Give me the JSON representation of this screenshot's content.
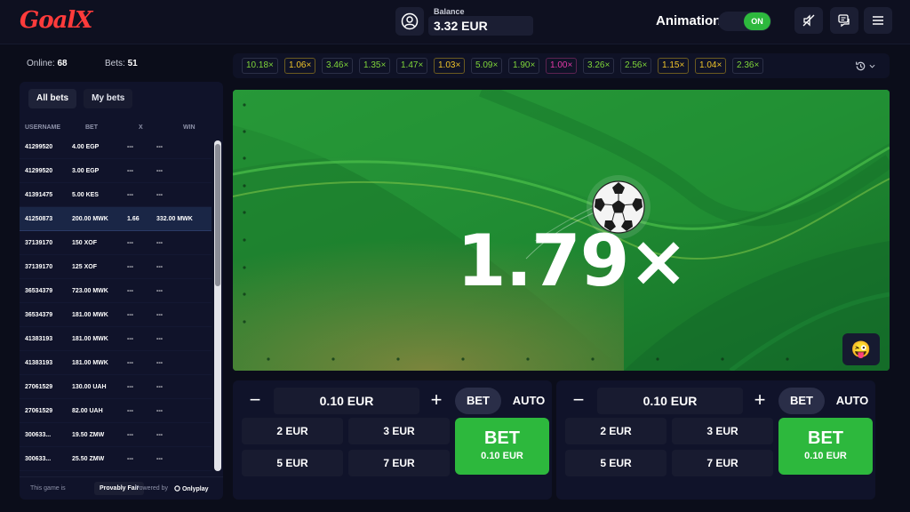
{
  "header": {
    "logo": "GoalX",
    "balance_label": "Balance",
    "balance_value": "3.32 EUR",
    "animation_label": "Animation",
    "animation_state": "ON"
  },
  "stats": {
    "online_label": "Online:",
    "online_value": "68",
    "bets_label": "Bets:",
    "bets_value": "51"
  },
  "bets_panel": {
    "tabs": [
      "All bets",
      "My bets"
    ],
    "columns": [
      "USERNAME",
      "BET",
      "X",
      "WIN"
    ],
    "rows": [
      {
        "user": "41299520",
        "bet": "4.00 EGP",
        "x": "---",
        "win": "---"
      },
      {
        "user": "41299520",
        "bet": "3.00 EGP",
        "x": "---",
        "win": "---"
      },
      {
        "user": "41391475",
        "bet": "5.00 KES",
        "x": "---",
        "win": "---"
      },
      {
        "user": "41250873",
        "bet": "200.00 MWK",
        "x": "1.66",
        "win": "332.00 MWK"
      },
      {
        "user": "37139170",
        "bet": "150 XOF",
        "x": "---",
        "win": "---"
      },
      {
        "user": "37139170",
        "bet": "125 XOF",
        "x": "---",
        "win": "---"
      },
      {
        "user": "36534379",
        "bet": "723.00 MWK",
        "x": "---",
        "win": "---"
      },
      {
        "user": "36534379",
        "bet": "181.00 MWK",
        "x": "---",
        "win": "---"
      },
      {
        "user": "41383193",
        "bet": "181.00 MWK",
        "x": "---",
        "win": "---"
      },
      {
        "user": "41383193",
        "bet": "181.00 MWK",
        "x": "---",
        "win": "---"
      },
      {
        "user": "27061529",
        "bet": "130.00 UAH",
        "x": "---",
        "win": "---"
      },
      {
        "user": "27061529",
        "bet": "82.00 UAH",
        "x": "---",
        "win": "---"
      },
      {
        "user": "300633...",
        "bet": "19.50 ZMW",
        "x": "---",
        "win": "---"
      },
      {
        "user": "300633...",
        "bet": "25.50 ZMW",
        "x": "---",
        "win": "---"
      }
    ],
    "footer_text": "This game is",
    "provably_fair": "Provably Fair",
    "powered_by": "Powered by",
    "provider": "Onlyplay"
  },
  "history": [
    {
      "value": "10.18×",
      "color": "#7fd63a"
    },
    {
      "value": "1.06×",
      "color": "#f0c42a"
    },
    {
      "value": "3.46×",
      "color": "#7fd63a"
    },
    {
      "value": "1.35×",
      "color": "#7fd63a"
    },
    {
      "value": "1.47×",
      "color": "#7fd63a"
    },
    {
      "value": "1.03×",
      "color": "#f0c42a"
    },
    {
      "value": "5.09×",
      "color": "#7fd63a"
    },
    {
      "value": "1.90×",
      "color": "#7fd63a"
    },
    {
      "value": "1.00×",
      "color": "#e33aa8"
    },
    {
      "value": "3.26×",
      "color": "#7fd63a"
    },
    {
      "value": "2.56×",
      "color": "#7fd63a"
    },
    {
      "value": "1.15×",
      "color": "#f0c42a"
    },
    {
      "value": "1.04×",
      "color": "#f0c42a"
    },
    {
      "value": "2.36×",
      "color": "#7fd63a"
    }
  ],
  "game": {
    "multiplier": "1.79×",
    "emoji": "😜"
  },
  "bet_panels": [
    {
      "minus": "−",
      "plus": "+",
      "amount": "0.10 EUR",
      "mode_bet": "BET",
      "mode_auto": "AUTO",
      "quick": [
        "2 EUR",
        "3 EUR",
        "5 EUR",
        "7 EUR"
      ],
      "bet_label": "BET",
      "bet_amount": "0.10 EUR"
    },
    {
      "minus": "−",
      "plus": "+",
      "amount": "0.10 EUR",
      "mode_bet": "BET",
      "mode_auto": "AUTO",
      "quick": [
        "2 EUR",
        "3 EUR",
        "5 EUR",
        "7 EUR"
      ],
      "bet_label": "BET",
      "bet_amount": "0.10 EUR"
    }
  ],
  "colors": {
    "accent_green": "#2db83d",
    "logo_red": "#ff3b3b",
    "background": "#0b0d1a"
  }
}
